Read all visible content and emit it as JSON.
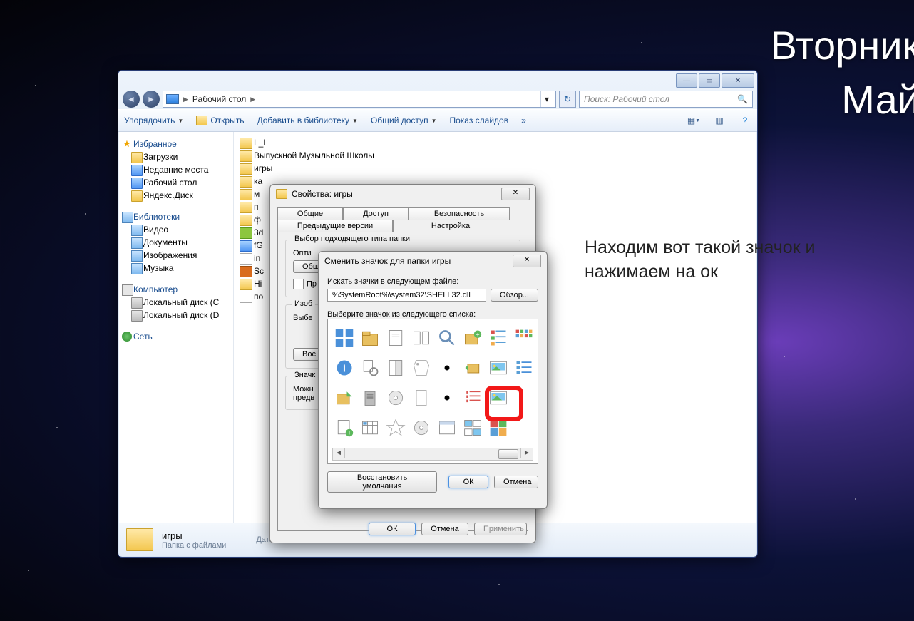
{
  "wallpaper": {
    "line1": "Вторник",
    "line2": "Май"
  },
  "annotation": "Находим вот такой значок и нажимаем на ок",
  "explorer": {
    "breadcrumb": "Рабочий стол",
    "search_placeholder": "Поиск: Рабочий стол",
    "toolbar": {
      "organize": "Упорядочить",
      "open": "Открыть",
      "add_library": "Добавить в библиотеку",
      "share": "Общий доступ",
      "slideshow": "Показ слайдов"
    },
    "sidebar": {
      "favorites": "Избранное",
      "fav_items": [
        "Загрузки",
        "Недавние места",
        "Рабочий стол",
        "Яндекс.Диск"
      ],
      "libraries": "Библиотеки",
      "lib_items": [
        "Видео",
        "Документы",
        "Изображения",
        "Музыка"
      ],
      "computer": "Компьютер",
      "comp_items": [
        "Локальный диск (C",
        "Локальный диск (D"
      ],
      "network": "Сеть"
    },
    "files": [
      "L_L",
      "Выпускной Музыльной Школы",
      "игры",
      "ка",
      "м",
      "п",
      "ф",
      "3d",
      "fG",
      "in",
      "Sc",
      "Hi",
      "по"
    ],
    "details": {
      "name": "игры",
      "type": "Папка с файлами",
      "meta_label": "Дата"
    }
  },
  "props": {
    "title": "Свойства: игры",
    "tabs": {
      "general": "Общие",
      "sharing": "Доступ",
      "security": "Безопасность",
      "prev": "Предыдущие версии",
      "customize": "Настройка"
    },
    "group1_label": "Выбор подходящего типа папки",
    "optimize": "Опти",
    "general_btn": "Общи",
    "also_apply": "Пр",
    "group2_label": "Изоб",
    "choose": "Выбе",
    "restore": "Вос",
    "group3_label": "Значк",
    "canchange": "Можн",
    "preview": "предв",
    "ok": "ОК",
    "cancel": "Отмена",
    "apply": "Применить"
  },
  "iconDlg": {
    "title": "Сменить значок для папки игры",
    "look_label": "Искать значки в следующем файле:",
    "path": "%SystemRoot%\\system32\\SHELL32.dll",
    "browse": "Обзор...",
    "select_label": "Выберите значок из следующего списка:",
    "restore": "Восстановить умолчания",
    "ok": "ОК",
    "cancel": "Отмена"
  }
}
